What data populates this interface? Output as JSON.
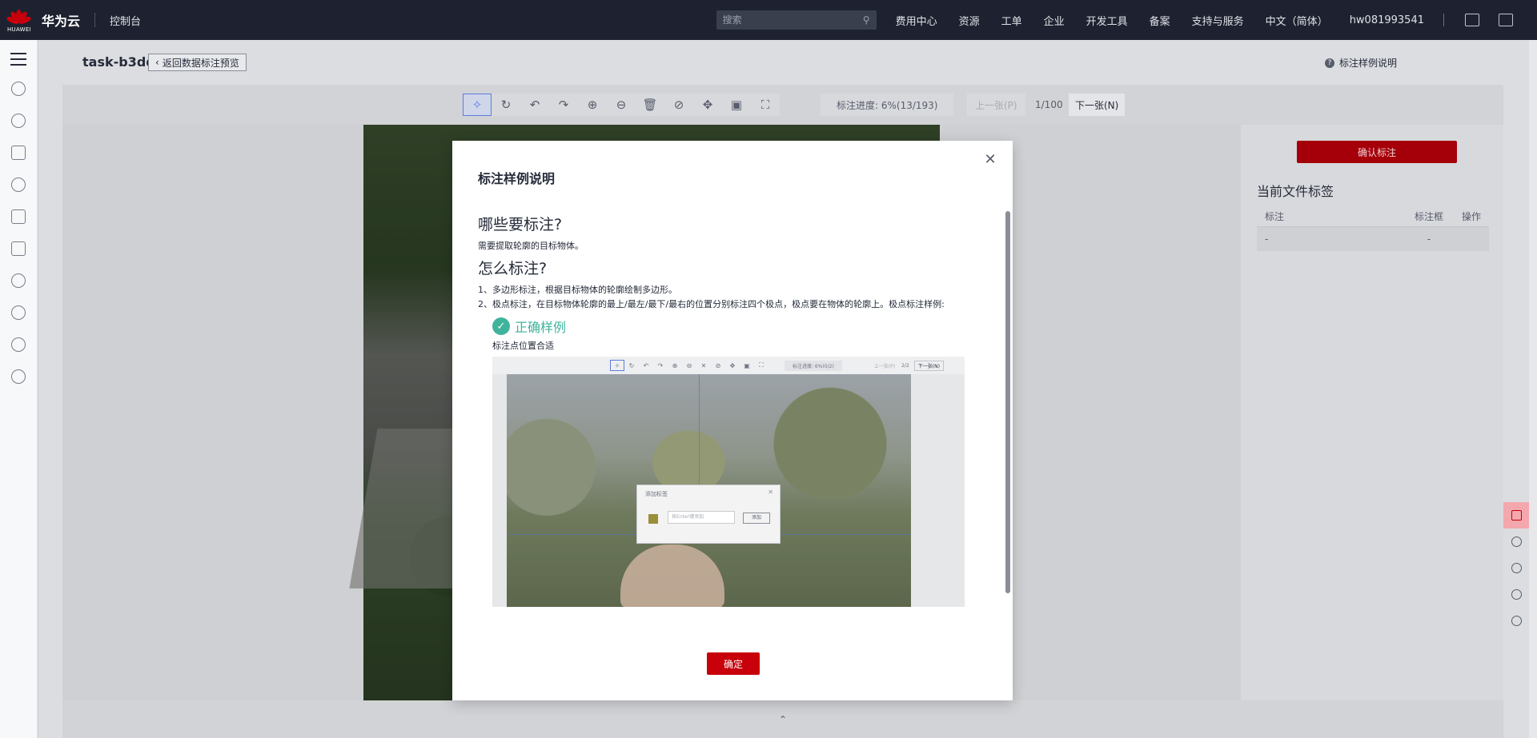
{
  "topbar": {
    "logo_text": "HUAWEI",
    "brand": "华为云",
    "console": "控制台",
    "search_placeholder": "搜索",
    "nav": [
      "费用中心",
      "资源",
      "工单",
      "企业",
      "开发工具",
      "备案",
      "支持与服务",
      "中文（简体）"
    ],
    "user": "hw081993541"
  },
  "header": {
    "task_title": "task-b3dd",
    "back_label": "返回数据标注预览",
    "help_label": "标注样例说明"
  },
  "toolbar": {
    "tools": [
      "polygon",
      "rotate",
      "undo",
      "redo",
      "zoom-in",
      "zoom-out",
      "delete",
      "hide",
      "move",
      "fit",
      "fullscreen"
    ],
    "progress": "标注进度: 6%(13/193)",
    "prev": "上一张(P)",
    "page": "1/100",
    "next": "下一张(N)"
  },
  "right_panel": {
    "confirm": "确认标注",
    "title": "当前文件标签",
    "col_label": "标注",
    "col_box": "标注框",
    "col_action": "操作",
    "row_label": "-",
    "row_box": "-"
  },
  "modal": {
    "title": "标注样例说明",
    "what_heading": "哪些要标注?",
    "what_text": "需要提取轮廓的目标物体。",
    "how_heading": "怎么标注?",
    "how_text_1": "1、多边形标注，根据目标物体的轮廓绘制多边形。",
    "how_text_2": "2、极点标注，在目标物体轮廓的最上/最左/最下/最右的位置分别标注四个极点，极点要在物体的轮廓上。极点标注样例:",
    "correct_label": "正确样例",
    "correct_sub": "标注点位置合适",
    "ok": "确定",
    "sample": {
      "progress": "标注进度: 6%(0/2)",
      "prev": "上一张(P)",
      "page": "2/2",
      "next": "下一张(N)",
      "dialog_title": "添加标签",
      "dialog_input": "按Enter键添加",
      "dialog_btn": "添加"
    }
  },
  "colors": {
    "topbar_bg": "#1e2230",
    "brand_red": "#c7000b",
    "success_green": "#3fb39b",
    "active_blue": "#5e7ce0"
  }
}
